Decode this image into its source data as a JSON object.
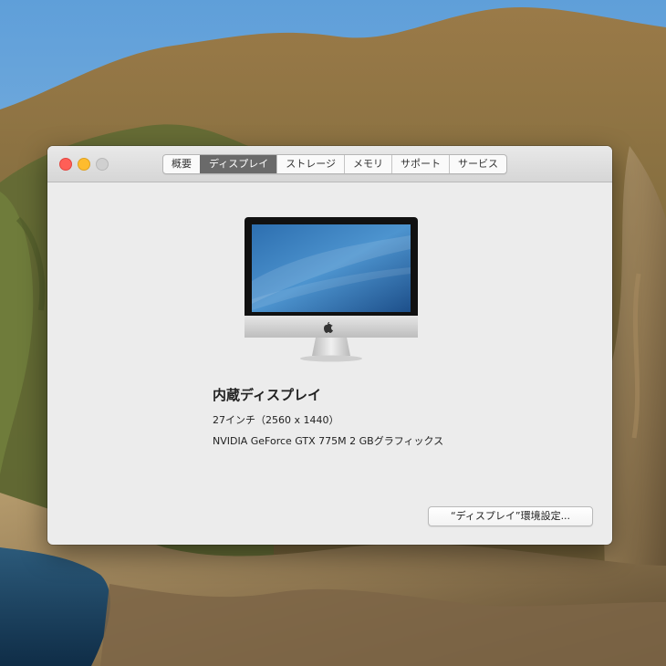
{
  "window": {
    "tabs": [
      {
        "label": "概要",
        "active": false
      },
      {
        "label": "ディスプレイ",
        "active": true
      },
      {
        "label": "ストレージ",
        "active": false
      },
      {
        "label": "メモリ",
        "active": false
      },
      {
        "label": "サポート",
        "active": false
      },
      {
        "label": "サービス",
        "active": false
      }
    ]
  },
  "display": {
    "name": "内蔵ディスプレイ",
    "size_resolution": "27インチ（2560 x 1440）",
    "graphics": "NVIDIA GeForce GTX 775M 2 GBグラフィックス"
  },
  "buttons": {
    "display_prefs": "“ディスプレイ”環境設定..."
  },
  "colors": {
    "close": "#ff5f57",
    "minimize": "#febc2e",
    "zoom_inactive": "#d0d0d0",
    "active_tab": "#6a6a6a"
  }
}
